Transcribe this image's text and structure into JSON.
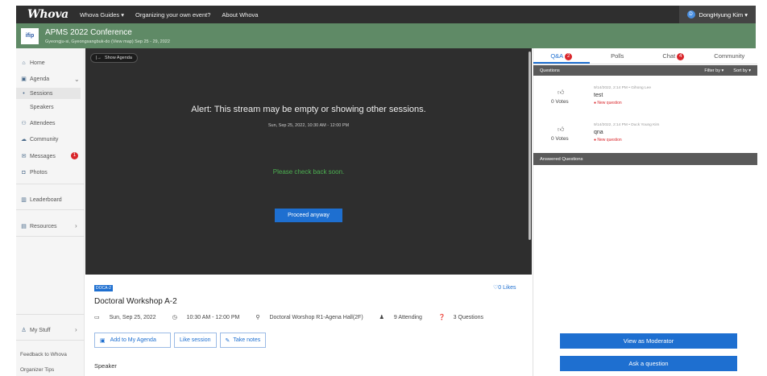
{
  "nav": {
    "logo": "Whova",
    "guides": "Whova Guides ▾",
    "organizing": "Organizing your own event?",
    "about": "About Whova",
    "user": "DongHyung Kim ▾",
    "user_initial": "D"
  },
  "event": {
    "logo": "ifip",
    "title": "APMS 2022 Conference",
    "subtitle": "Gyeongju-si, Gyeongsangbuk-do (View map)  Sep 25 - 29, 2022"
  },
  "sidebar": {
    "home": "Home",
    "agenda": "Agenda",
    "sessions": "Sessions",
    "speakers": "Speakers",
    "attendees": "Attendees",
    "community": "Community",
    "messages": "Messages",
    "messages_badge": "1",
    "photos": "Photos",
    "leaderboard": "Leaderboard",
    "resources": "Resources",
    "my_stuff": "My Stuff",
    "feedback": "Feedback to Whova",
    "organizer_tips": "Organizer Tips"
  },
  "video": {
    "show_agenda": "Show Agenda",
    "alert": "Alert: This stream may be empty or showing other sessions.",
    "date": "Sun, Sep 25, 2022, 10:30 AM - 12:00 PM",
    "check_back": "Please check back soon.",
    "proceed": "Proceed anyway"
  },
  "session": {
    "tag": "DOCA-2",
    "likes": "0 Likes",
    "title": "Doctoral Workshop A-2",
    "date": "Sun, Sep 25, 2022",
    "time": "10:30 AM - 12:00 PM",
    "location": "Doctoral Worshop R1-Agena Hall(2F)",
    "attending": "9 Attending",
    "questions": "3 Questions",
    "add_agenda": "Add to My Agenda",
    "like_session": "Like session",
    "take_notes": "Take notes",
    "speaker_label": "Speaker"
  },
  "panel": {
    "tabs": [
      {
        "label": "Q&A",
        "badge": "2"
      },
      {
        "label": "Polls",
        "badge": ""
      },
      {
        "label": "Chat",
        "badge": "4"
      },
      {
        "label": "Community",
        "badge": ""
      }
    ],
    "questions_header": "Questions",
    "filter": "Filter by ▾",
    "sort": "Sort by ▾",
    "questions": [
      {
        "meta": "9/14/2022, 2:14 PM • Gihong Lee",
        "text": "test",
        "votes": "0  Votes",
        "status": "● New question"
      },
      {
        "meta": "9/14/2022, 2:14 PM • Duck Young Kim",
        "text": "qna",
        "votes": "0  Votes",
        "status": "● New question"
      }
    ],
    "answered_header": "Answered Questions",
    "moderator_btn": "View as Moderator",
    "ask_btn": "Ask a question"
  },
  "colors": {
    "accent": "#1e6fd0",
    "header_green": "#5f8a66",
    "nav_dark": "#2f2f2f",
    "badge_red": "#d9262b"
  }
}
